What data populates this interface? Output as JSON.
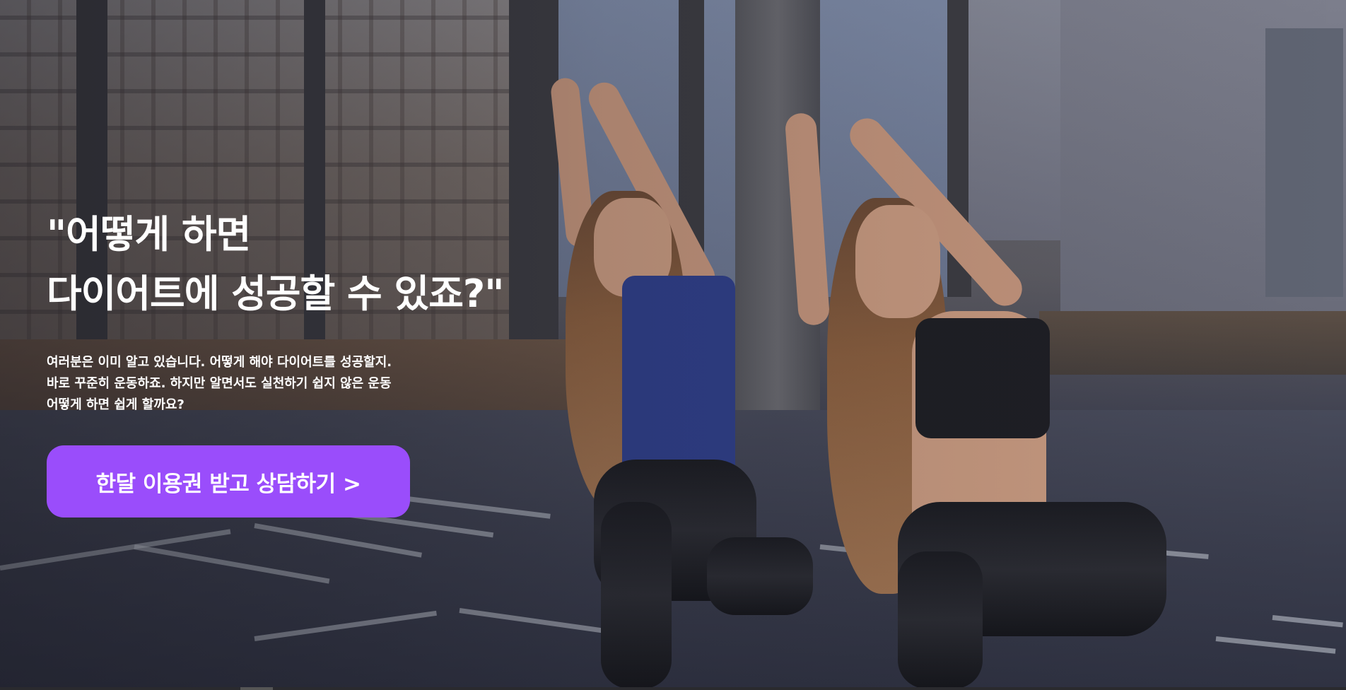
{
  "hero": {
    "headline_line1": "\"어떻게 하면",
    "headline_line2": "다이어트에 성공할 수 있죠?\"",
    "description_lines": [
      "여러분은 이미 알고 있습니다. 어떻게 해야 다이어트를 성공할지.",
      "바로 꾸준히 운동하죠. 하지만 알면서도 실천하기 쉽지 않은 운동",
      "어떻게 하면 쉽게 할까요?"
    ],
    "cta_label": "한달 이용권 받고 상담하기 >"
  },
  "colors": {
    "cta_background": "#9a4dfb",
    "text": "#ffffff"
  }
}
